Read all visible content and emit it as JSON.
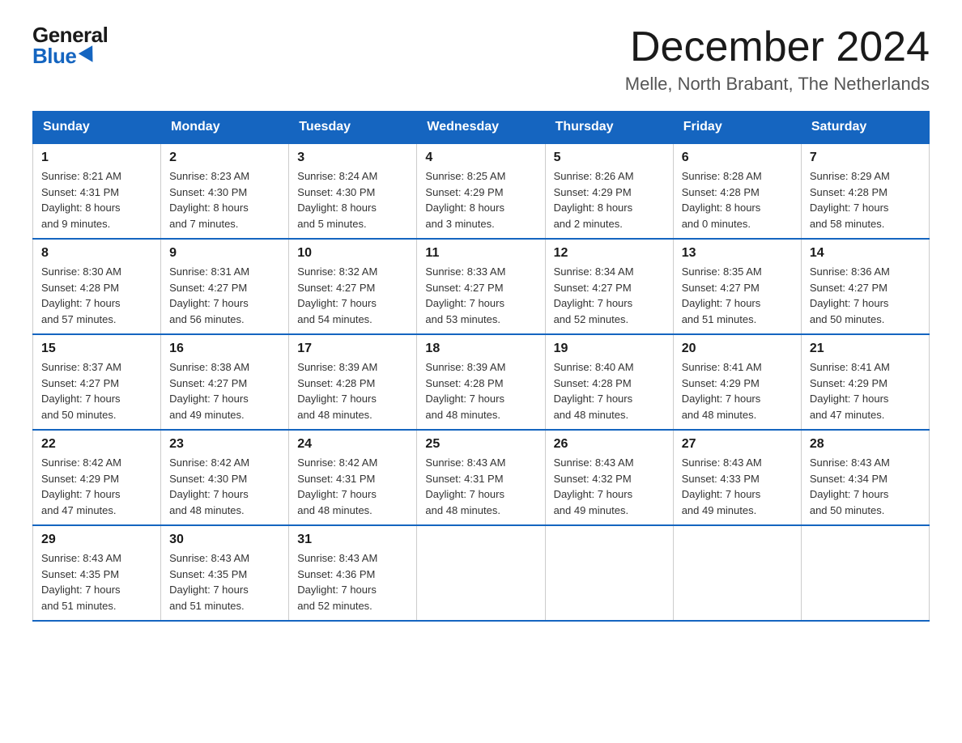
{
  "logo": {
    "general": "General",
    "blue": "Blue"
  },
  "title": "December 2024",
  "location": "Melle, North Brabant, The Netherlands",
  "days_of_week": [
    "Sunday",
    "Monday",
    "Tuesday",
    "Wednesday",
    "Thursday",
    "Friday",
    "Saturday"
  ],
  "weeks": [
    [
      {
        "day": "1",
        "info": "Sunrise: 8:21 AM\nSunset: 4:31 PM\nDaylight: 8 hours\nand 9 minutes."
      },
      {
        "day": "2",
        "info": "Sunrise: 8:23 AM\nSunset: 4:30 PM\nDaylight: 8 hours\nand 7 minutes."
      },
      {
        "day": "3",
        "info": "Sunrise: 8:24 AM\nSunset: 4:30 PM\nDaylight: 8 hours\nand 5 minutes."
      },
      {
        "day": "4",
        "info": "Sunrise: 8:25 AM\nSunset: 4:29 PM\nDaylight: 8 hours\nand 3 minutes."
      },
      {
        "day": "5",
        "info": "Sunrise: 8:26 AM\nSunset: 4:29 PM\nDaylight: 8 hours\nand 2 minutes."
      },
      {
        "day": "6",
        "info": "Sunrise: 8:28 AM\nSunset: 4:28 PM\nDaylight: 8 hours\nand 0 minutes."
      },
      {
        "day": "7",
        "info": "Sunrise: 8:29 AM\nSunset: 4:28 PM\nDaylight: 7 hours\nand 58 minutes."
      }
    ],
    [
      {
        "day": "8",
        "info": "Sunrise: 8:30 AM\nSunset: 4:28 PM\nDaylight: 7 hours\nand 57 minutes."
      },
      {
        "day": "9",
        "info": "Sunrise: 8:31 AM\nSunset: 4:27 PM\nDaylight: 7 hours\nand 56 minutes."
      },
      {
        "day": "10",
        "info": "Sunrise: 8:32 AM\nSunset: 4:27 PM\nDaylight: 7 hours\nand 54 minutes."
      },
      {
        "day": "11",
        "info": "Sunrise: 8:33 AM\nSunset: 4:27 PM\nDaylight: 7 hours\nand 53 minutes."
      },
      {
        "day": "12",
        "info": "Sunrise: 8:34 AM\nSunset: 4:27 PM\nDaylight: 7 hours\nand 52 minutes."
      },
      {
        "day": "13",
        "info": "Sunrise: 8:35 AM\nSunset: 4:27 PM\nDaylight: 7 hours\nand 51 minutes."
      },
      {
        "day": "14",
        "info": "Sunrise: 8:36 AM\nSunset: 4:27 PM\nDaylight: 7 hours\nand 50 minutes."
      }
    ],
    [
      {
        "day": "15",
        "info": "Sunrise: 8:37 AM\nSunset: 4:27 PM\nDaylight: 7 hours\nand 50 minutes."
      },
      {
        "day": "16",
        "info": "Sunrise: 8:38 AM\nSunset: 4:27 PM\nDaylight: 7 hours\nand 49 minutes."
      },
      {
        "day": "17",
        "info": "Sunrise: 8:39 AM\nSunset: 4:28 PM\nDaylight: 7 hours\nand 48 minutes."
      },
      {
        "day": "18",
        "info": "Sunrise: 8:39 AM\nSunset: 4:28 PM\nDaylight: 7 hours\nand 48 minutes."
      },
      {
        "day": "19",
        "info": "Sunrise: 8:40 AM\nSunset: 4:28 PM\nDaylight: 7 hours\nand 48 minutes."
      },
      {
        "day": "20",
        "info": "Sunrise: 8:41 AM\nSunset: 4:29 PM\nDaylight: 7 hours\nand 48 minutes."
      },
      {
        "day": "21",
        "info": "Sunrise: 8:41 AM\nSunset: 4:29 PM\nDaylight: 7 hours\nand 47 minutes."
      }
    ],
    [
      {
        "day": "22",
        "info": "Sunrise: 8:42 AM\nSunset: 4:29 PM\nDaylight: 7 hours\nand 47 minutes."
      },
      {
        "day": "23",
        "info": "Sunrise: 8:42 AM\nSunset: 4:30 PM\nDaylight: 7 hours\nand 48 minutes."
      },
      {
        "day": "24",
        "info": "Sunrise: 8:42 AM\nSunset: 4:31 PM\nDaylight: 7 hours\nand 48 minutes."
      },
      {
        "day": "25",
        "info": "Sunrise: 8:43 AM\nSunset: 4:31 PM\nDaylight: 7 hours\nand 48 minutes."
      },
      {
        "day": "26",
        "info": "Sunrise: 8:43 AM\nSunset: 4:32 PM\nDaylight: 7 hours\nand 49 minutes."
      },
      {
        "day": "27",
        "info": "Sunrise: 8:43 AM\nSunset: 4:33 PM\nDaylight: 7 hours\nand 49 minutes."
      },
      {
        "day": "28",
        "info": "Sunrise: 8:43 AM\nSunset: 4:34 PM\nDaylight: 7 hours\nand 50 minutes."
      }
    ],
    [
      {
        "day": "29",
        "info": "Sunrise: 8:43 AM\nSunset: 4:35 PM\nDaylight: 7 hours\nand 51 minutes."
      },
      {
        "day": "30",
        "info": "Sunrise: 8:43 AM\nSunset: 4:35 PM\nDaylight: 7 hours\nand 51 minutes."
      },
      {
        "day": "31",
        "info": "Sunrise: 8:43 AM\nSunset: 4:36 PM\nDaylight: 7 hours\nand 52 minutes."
      },
      {
        "day": "",
        "info": ""
      },
      {
        "day": "",
        "info": ""
      },
      {
        "day": "",
        "info": ""
      },
      {
        "day": "",
        "info": ""
      }
    ]
  ]
}
